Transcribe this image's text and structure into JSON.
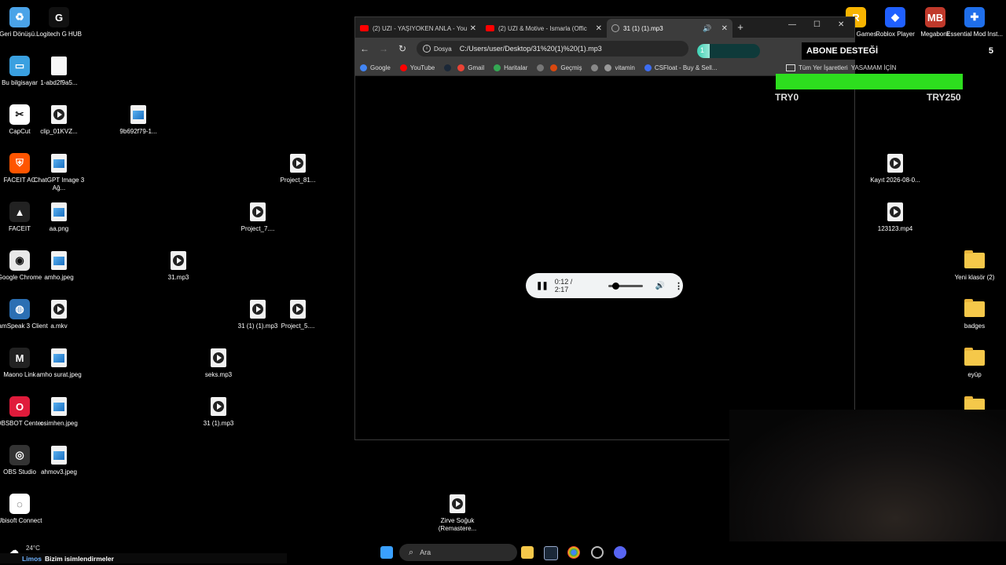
{
  "desktop_left": [
    {
      "name": "recycle",
      "label": "Geri Dönüşü...",
      "kind": "app",
      "color": "#4aa3e8",
      "glyph": "♻"
    },
    {
      "name": "logitech",
      "label": "Logitech G HUB",
      "kind": "app",
      "color": "#111",
      "glyph": "G"
    },
    {
      "name": "bu-bilgisayar",
      "label": "Bu bilgisayar",
      "kind": "app",
      "color": "#3aa0e0",
      "glyph": "▭"
    },
    {
      "name": "file-1abd",
      "label": "1-abd2f9a5...",
      "kind": "blank"
    },
    {
      "name": "capcut",
      "label": "CapCut",
      "kind": "app",
      "color": "#fff",
      "glyph": "✂"
    },
    {
      "name": "clip-01kvz",
      "label": "clip_01KVZ...",
      "kind": "media"
    },
    {
      "name": "file-9b692",
      "label": "9b692f79-1...",
      "kind": "image"
    },
    {
      "name": "faceit-ac",
      "label": "FACEIT AC",
      "kind": "app",
      "color": "#ff5500",
      "glyph": "⛨"
    },
    {
      "name": "chatgpt-image",
      "label": "ChatGPT Image 3 Ağ...",
      "kind": "image"
    },
    {
      "name": "faceit",
      "label": "FACEIT",
      "kind": "app",
      "color": "#222",
      "glyph": "▲"
    },
    {
      "name": "aa-png",
      "label": "aa.png",
      "kind": "image"
    },
    {
      "name": "chrome",
      "label": "Google Chrome",
      "kind": "app",
      "color": "#e8e8e8",
      "glyph": "◉"
    },
    {
      "name": "amho-jpeg",
      "label": "amho.jpeg",
      "kind": "image"
    },
    {
      "name": "teamspeak",
      "label": "TeamSpeak 3 Client",
      "kind": "app",
      "color": "#2b6fb3",
      "glyph": "◍"
    },
    {
      "name": "a-mkv",
      "label": "a.mkv",
      "kind": "media"
    },
    {
      "name": "maono",
      "label": "Maono Link",
      "kind": "app",
      "color": "#222",
      "glyph": "M"
    },
    {
      "name": "amho-surat",
      "label": "amho surat.jpeg",
      "kind": "image"
    },
    {
      "name": "obsbot",
      "label": "OBSBOT Center",
      "kind": "app",
      "color": "#e01b3b",
      "glyph": "O"
    },
    {
      "name": "osimhen",
      "label": "osimhen.jpeg",
      "kind": "image"
    },
    {
      "name": "obs-studio",
      "label": "OBS Studio",
      "kind": "app",
      "color": "#333",
      "glyph": "◎"
    },
    {
      "name": "ahmov3",
      "label": "ahmov3.jpeg",
      "kind": "image"
    },
    {
      "name": "ubisoft",
      "label": "Ubisoft Connect",
      "kind": "app",
      "color": "#fff",
      "glyph": "◌"
    }
  ],
  "desktop_middle": [
    {
      "name": "project-81",
      "label": "Project_81...",
      "kind": "media"
    },
    {
      "name": "project-7",
      "label": "Project_7....",
      "kind": "media"
    },
    {
      "name": "31-mp3",
      "label": "31.mp3",
      "kind": "media"
    },
    {
      "name": "31-1-1-mp3",
      "label": "31 (1) (1).mp3",
      "kind": "media"
    },
    {
      "name": "project-5",
      "label": "Project_5....",
      "kind": "media"
    },
    {
      "name": "seks-mp3",
      "label": "seks.mp3",
      "kind": "media"
    },
    {
      "name": "31-1-mp3",
      "label": "31 (1).mp3",
      "kind": "media"
    },
    {
      "name": "zirve-soguk",
      "label": "Zirve Soğuk (Remastere...",
      "kind": "media"
    }
  ],
  "desktop_right": [
    {
      "name": "rockstar",
      "label": "Rockstar Games...",
      "kind": "app",
      "color": "#f8b400",
      "glyph": "R"
    },
    {
      "name": "roblox",
      "label": "Roblox Player",
      "kind": "app",
      "color": "#2060ff",
      "glyph": "◆"
    },
    {
      "name": "megabonk",
      "label": "Megabonk",
      "kind": "app",
      "color": "#c0392b",
      "glyph": "MB"
    },
    {
      "name": "essential-mod",
      "label": "Essential Mod Inst...",
      "kind": "app",
      "color": "#1f6feb",
      "glyph": "✚"
    },
    {
      "name": "kayit",
      "label": "Kayıt 2026-08-0...",
      "kind": "media"
    },
    {
      "name": "123123-mp4",
      "label": "123123.mp4",
      "kind": "media"
    },
    {
      "name": "yeni-klasor",
      "label": "Yeni klasör (2)",
      "kind": "folder"
    },
    {
      "name": "badges",
      "label": "badges",
      "kind": "folder"
    },
    {
      "name": "eyup",
      "label": "eyüp",
      "kind": "folder"
    },
    {
      "name": "folder-extra",
      "label": "",
      "kind": "folder"
    }
  ],
  "browser": {
    "tabs": [
      {
        "label": "(2) UZI - YAŞIYOKEN ANLA - You",
        "type": "youtube"
      },
      {
        "label": "(2) UZI & Motive - Ismarla (Offic",
        "type": "youtube"
      },
      {
        "label": "31 (1) (1).mp3",
        "type": "file"
      }
    ],
    "new_tab": "+",
    "address_chip": "Dosya",
    "address": "C:/Users/user/Desktop/31%20(1)%20(1).mp3",
    "bookmarks": [
      {
        "label": "Google",
        "color": "#4285f4"
      },
      {
        "label": "YouTube",
        "color": "#ff0000"
      },
      {
        "label": "",
        "color": "#1b2838"
      },
      {
        "label": "Gmail",
        "color": "#ea4335"
      },
      {
        "label": "Haritalar",
        "color": "#34a853"
      },
      {
        "label": "",
        "color": "#777"
      },
      {
        "label": "Geçmiş",
        "color": "#d9480f"
      },
      {
        "label": "",
        "color": "#888"
      },
      {
        "label": "vitamin",
        "color": "#999"
      },
      {
        "label": "CSFloat - Buy & Sell...",
        "color": "#3d6df2"
      }
    ],
    "all_bookmarks": "Tüm Yer İşaretleri",
    "player": {
      "time": "0:12 / 2:17",
      "progress": 0.1
    }
  },
  "overlay": {
    "title": "ABONE DESTEĞİ",
    "count": "5",
    "goal_current": "1",
    "goal_fill": 0.2,
    "left_label": "TRY0",
    "right_label": "TRY250",
    "scrolling_name": "YASAMAM İÇİN"
  },
  "taskbar": {
    "weather_temp": "24°C",
    "ticker_prefix": "Limos",
    "ticker_text": "Bizim isimlendirmeler",
    "search_placeholder": "Ara"
  }
}
